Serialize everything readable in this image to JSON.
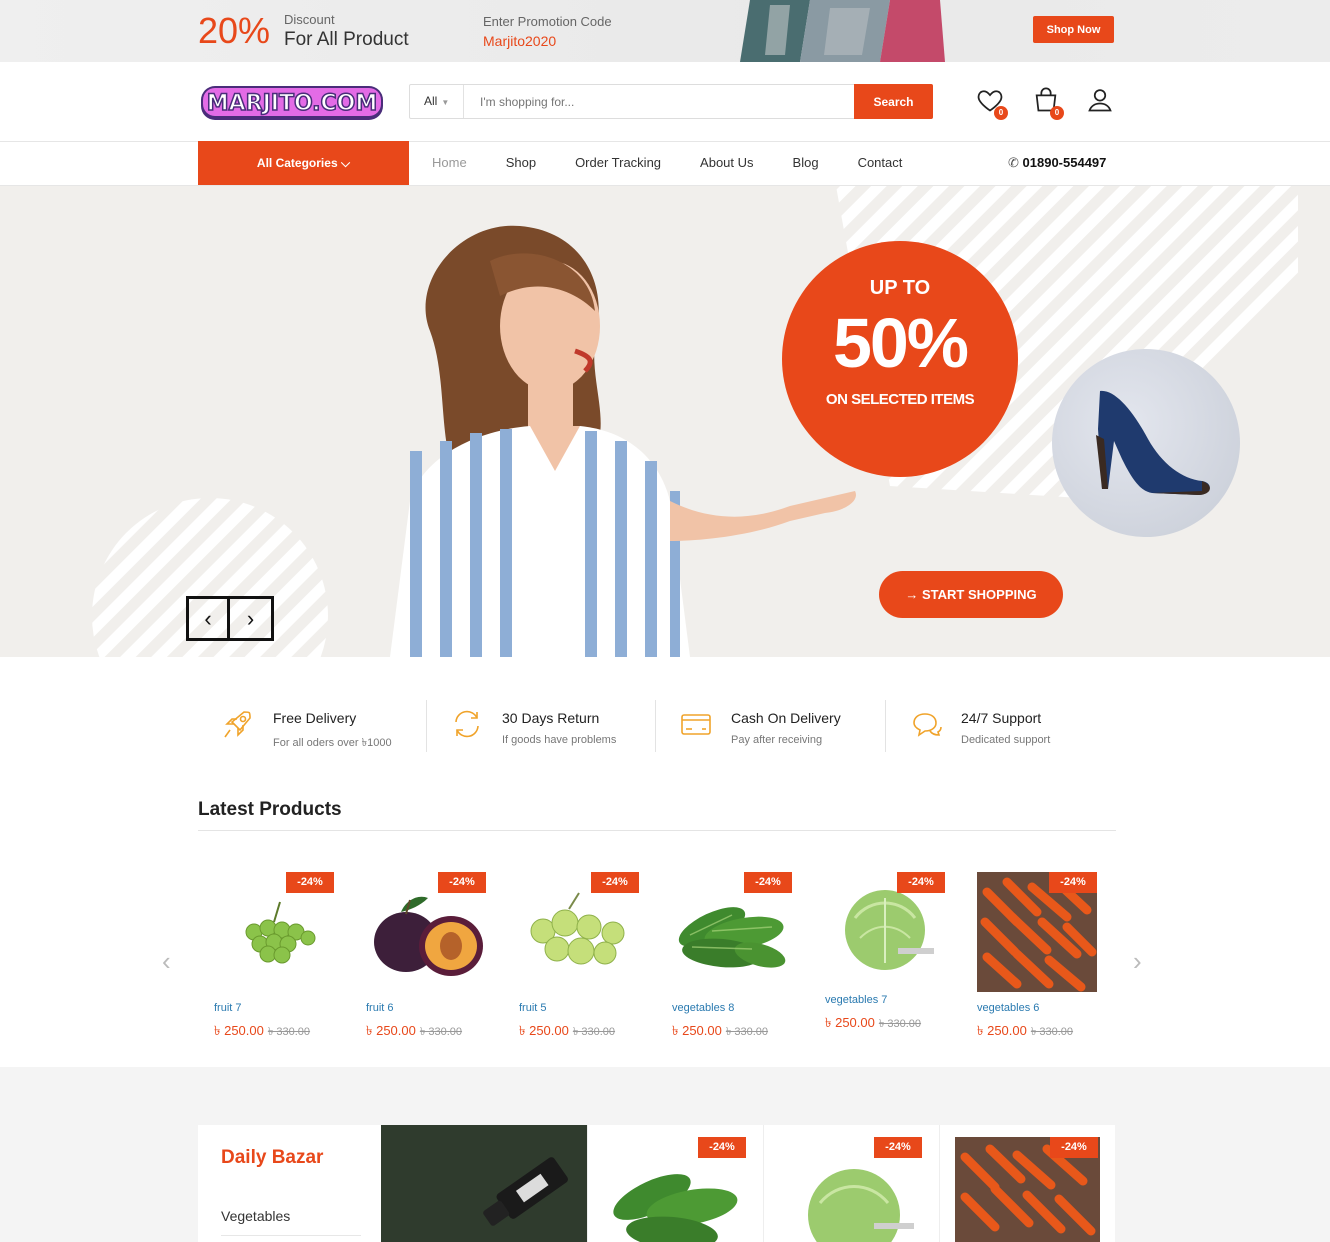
{
  "promo_bar": {
    "percent": "20%",
    "discount_label": "Discount",
    "discount_text": "For All Product",
    "code_label": "Enter Promotion Code",
    "code_value": "Marjito2020",
    "shop_now": "Shop Now"
  },
  "header": {
    "logo_text": "MARJITO.COM",
    "search_category": "All",
    "search_placeholder": "I'm shopping for...",
    "search_button": "Search",
    "wishlist_count": "0",
    "cart_count": "0"
  },
  "nav": {
    "all_categories": "All Categories",
    "links": [
      "Home",
      "Shop",
      "Order Tracking",
      "About Us",
      "Blog",
      "Contact"
    ],
    "phone": "01890-554497"
  },
  "hero": {
    "up_to": "UP TO",
    "percent": "50%",
    "selected": "ON SELECTED ITEMS",
    "start_button": "START SHOPPING"
  },
  "features": [
    {
      "title": "Free Delivery",
      "subtitle": "For all oders over ৳1000",
      "icon": "rocket-icon"
    },
    {
      "title": "30 Days Return",
      "subtitle": "If goods have problems",
      "icon": "refresh-icon"
    },
    {
      "title": "Cash On Delivery",
      "subtitle": "Pay after receiving",
      "icon": "credit-card-icon"
    },
    {
      "title": "24/7 Support",
      "subtitle": "Dedicated support",
      "icon": "chat-icon"
    }
  ],
  "latest": {
    "title": "Latest Products",
    "products": [
      {
        "name": "fruit 7",
        "price": "৳ 250.00",
        "old_price": "৳ 330.00",
        "discount": "-24%"
      },
      {
        "name": "fruit 6",
        "price": "৳ 250.00",
        "old_price": "৳ 330.00",
        "discount": "-24%"
      },
      {
        "name": "fruit 5",
        "price": "৳ 250.00",
        "old_price": "৳ 330.00",
        "discount": "-24%"
      },
      {
        "name": "vegetables 8",
        "price": "৳ 250.00",
        "old_price": "৳ 330.00",
        "discount": "-24%"
      },
      {
        "name": "vegetables 7",
        "price": "৳ 250.00",
        "old_price": "৳ 330.00",
        "discount": "-24%"
      },
      {
        "name": "vegetables 6",
        "price": "৳ 250.00",
        "old_price": "৳ 330.00",
        "discount": "-24%"
      }
    ]
  },
  "daily": {
    "title": "Daily Bazar",
    "first_category": "Vegetables",
    "discounts": [
      "-24%",
      "-24%",
      "-24%"
    ]
  },
  "colors": {
    "accent": "#e8481a",
    "link": "#2a7ab0"
  }
}
